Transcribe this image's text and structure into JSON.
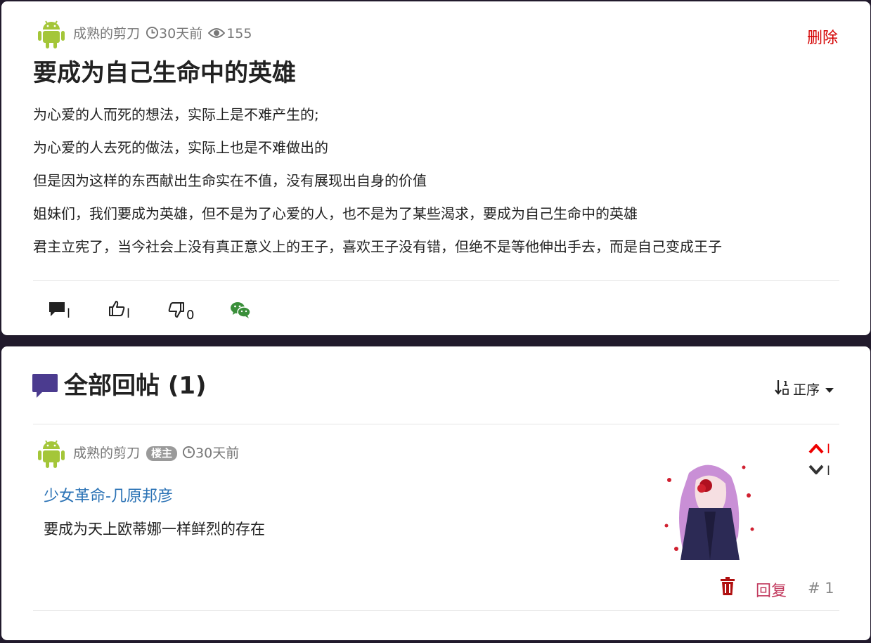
{
  "post": {
    "author": "成熟的剪刀",
    "time": "30天前",
    "views": "155",
    "delete_label": "删除",
    "title": "要成为自己生命中的英雄",
    "paragraphs": [
      "为心爱的人而死的想法，实际上是不难产生的;",
      "为心爱的人去死的做法，实际上也是不难做出的",
      "但是因为这样的东西献出生命实在不值，没有展现出自身的价值",
      "姐妹们，我们要成为英雄，但不是为了心爱的人，也不是为了某些渴求，要成为自己生命中的英雄",
      "君主立宪了，当今社会上没有真正意义上的王子，喜欢王子没有错，但绝不是等他伸出手去，而是自己变成王子"
    ],
    "actions": {
      "comment_count": "l",
      "like_count": "l",
      "dislike_count": "0"
    }
  },
  "replies": {
    "title": "全部回帖 (1)",
    "sort_label": "正序",
    "items": [
      {
        "author": "成熟的剪刀",
        "badge": "楼主",
        "time": "30天前",
        "link_text": "少女革命-几原邦彦",
        "text": "要成为天上欧蒂娜一样鲜烈的存在",
        "up_count": "l",
        "down_count": "l",
        "reply_label": "回复",
        "floor": "# 1"
      }
    ]
  },
  "colors": {
    "android_green": "#a4c639",
    "accent_purple": "#4b3b8f",
    "delete_red": "#d40000",
    "link_blue": "#2a72b5",
    "reply_pink": "#c23a5e"
  }
}
